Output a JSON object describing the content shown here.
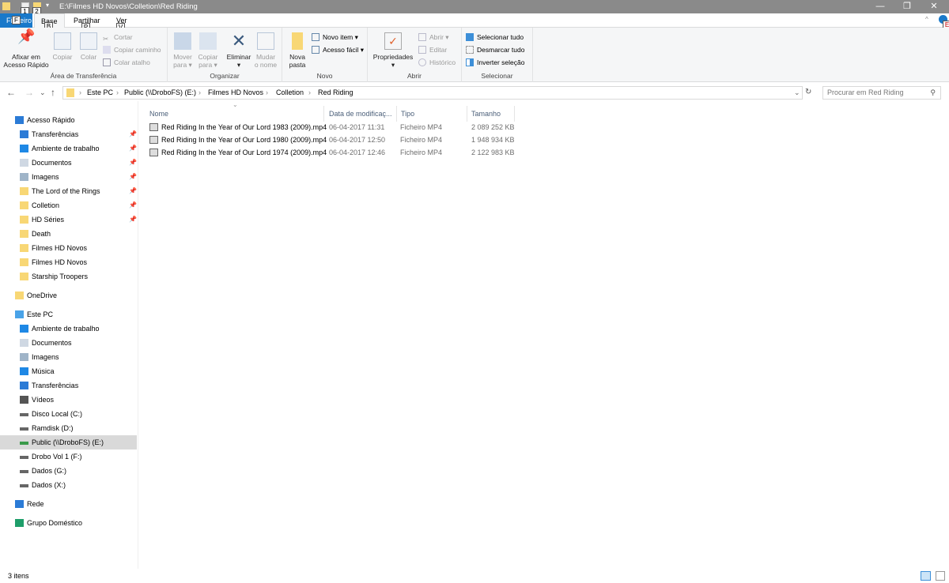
{
  "title": "E:\\Filmes HD Novos\\Colletion\\Red Riding",
  "quick_access_keys": [
    "1",
    "2"
  ],
  "window_controls": {
    "minimize": "—",
    "maximize": "❐",
    "close": "✕"
  },
  "tabs": [
    {
      "label": "Ficheiro",
      "key": "F"
    },
    {
      "label": "Base",
      "key": "B"
    },
    {
      "label": "Partilhar",
      "key": "P"
    },
    {
      "label": "Ver",
      "key": "V"
    }
  ],
  "help_key": "E",
  "ribbon": {
    "clipboard": {
      "label": "Área de Transferência",
      "pin": "Afixar em\nAcesso Rápido",
      "copy": "Copiar",
      "paste": "Colar",
      "cut": "Cortar",
      "copy_path": "Copiar caminho",
      "paste_shortcut": "Colar atalho"
    },
    "organize": {
      "label": "Organizar",
      "move": "Mover\npara ▾",
      "copy_to": "Copiar\npara ▾",
      "delete": "Eliminar\n▾",
      "rename": "Mudar\no nome"
    },
    "new": {
      "label": "Novo",
      "new_folder": "Nova\npasta",
      "new_item": "Novo item ▾",
      "easy_access": "Acesso fácil ▾"
    },
    "open": {
      "label": "Abrir",
      "properties": "Propriedades\n▾",
      "open": "Abrir ▾",
      "edit": "Editar",
      "history": "Histórico"
    },
    "select": {
      "label": "Selecionar",
      "select_all": "Selecionar tudo",
      "select_none": "Desmarcar tudo",
      "invert": "Inverter seleção"
    }
  },
  "nav": {
    "back": "←",
    "forward": "→",
    "recent": "⌄",
    "up": "↑",
    "dropdown": "⌄",
    "refresh": "↻"
  },
  "breadcrumb": [
    "Este PC",
    "Public (\\\\DroboFS) (E:)",
    "Filmes HD Novos",
    "Colletion",
    "Red Riding"
  ],
  "search_placeholder": "Procurar em Red Riding",
  "sidebar": [
    {
      "label": "Acesso Rápido",
      "icon": "star",
      "level": 0
    },
    {
      "label": "Transferências",
      "icon": "download",
      "level": 1,
      "pinned": true
    },
    {
      "label": "Ambiente de trabalho",
      "icon": "desktop",
      "level": 1,
      "pinned": true
    },
    {
      "label": "Documentos",
      "icon": "documents",
      "level": 1,
      "pinned": true
    },
    {
      "label": "Imagens",
      "icon": "pictures",
      "level": 1,
      "pinned": true
    },
    {
      "label": "The Lord of the Rings",
      "icon": "folder",
      "level": 1,
      "pinned": true
    },
    {
      "label": "Colletion",
      "icon": "folder",
      "level": 1,
      "pinned": true
    },
    {
      "label": "HD Séries",
      "icon": "folder",
      "level": 1,
      "pinned": true
    },
    {
      "label": "Death",
      "icon": "folder",
      "level": 1
    },
    {
      "label": "Filmes HD Novos",
      "icon": "folder",
      "level": 1
    },
    {
      "label": "Filmes HD Novos",
      "icon": "folder",
      "level": 1
    },
    {
      "label": "Starship Troopers",
      "icon": "folder",
      "level": 1
    },
    {
      "label": "OneDrive",
      "icon": "folder",
      "level": 0,
      "gap": true
    },
    {
      "label": "Este PC",
      "icon": "pc",
      "level": 0,
      "gap": true
    },
    {
      "label": "Ambiente de trabalho",
      "icon": "desktop",
      "level": 1
    },
    {
      "label": "Documentos",
      "icon": "documents",
      "level": 1
    },
    {
      "label": "Imagens",
      "icon": "pictures",
      "level": 1
    },
    {
      "label": "Música",
      "icon": "music",
      "level": 1
    },
    {
      "label": "Transferências",
      "icon": "download",
      "level": 1
    },
    {
      "label": "Vídeos",
      "icon": "videos",
      "level": 1
    },
    {
      "label": "Disco Local (C:)",
      "icon": "drive",
      "level": 1
    },
    {
      "label": "Ramdisk (D:)",
      "icon": "drive",
      "level": 1
    },
    {
      "label": "Public (\\\\DroboFS) (E:)",
      "icon": "network-drive",
      "level": 1,
      "selected": true
    },
    {
      "label": "Drobo Vol 1 (F:)",
      "icon": "drive",
      "level": 1
    },
    {
      "label": "Dados (G:)",
      "icon": "drive",
      "level": 1
    },
    {
      "label": "Dados (X:)",
      "icon": "drive",
      "level": 1
    },
    {
      "label": "Rede",
      "icon": "network",
      "level": 0,
      "gap": true
    },
    {
      "label": "Grupo Doméstico",
      "icon": "homegroup",
      "level": 0,
      "gap": true
    }
  ],
  "columns": [
    "Nome",
    "Data de modificaç...",
    "Tipo",
    "Tamanho"
  ],
  "files": [
    {
      "name": "Red Riding In the Year of Our Lord 1983 (2009).mp4",
      "date": "06-04-2017 11:31",
      "type": "Ficheiro MP4",
      "size": "2 089 252 KB"
    },
    {
      "name": "Red Riding In the Year of Our Lord 1980 (2009).mp4",
      "date": "06-04-2017 12:50",
      "type": "Ficheiro MP4",
      "size": "1 948 934 KB"
    },
    {
      "name": "Red Riding In the Year of Our Lord 1974 (2009).mp4",
      "date": "06-04-2017 12:46",
      "type": "Ficheiro MP4",
      "size": "2 122 983 KB"
    }
  ],
  "status": "3 itens",
  "colors": {
    "accent": "#1979ca",
    "titlebar": "#8a8a8a",
    "folder": "#f8d775",
    "selection": "#d9d9d9"
  }
}
